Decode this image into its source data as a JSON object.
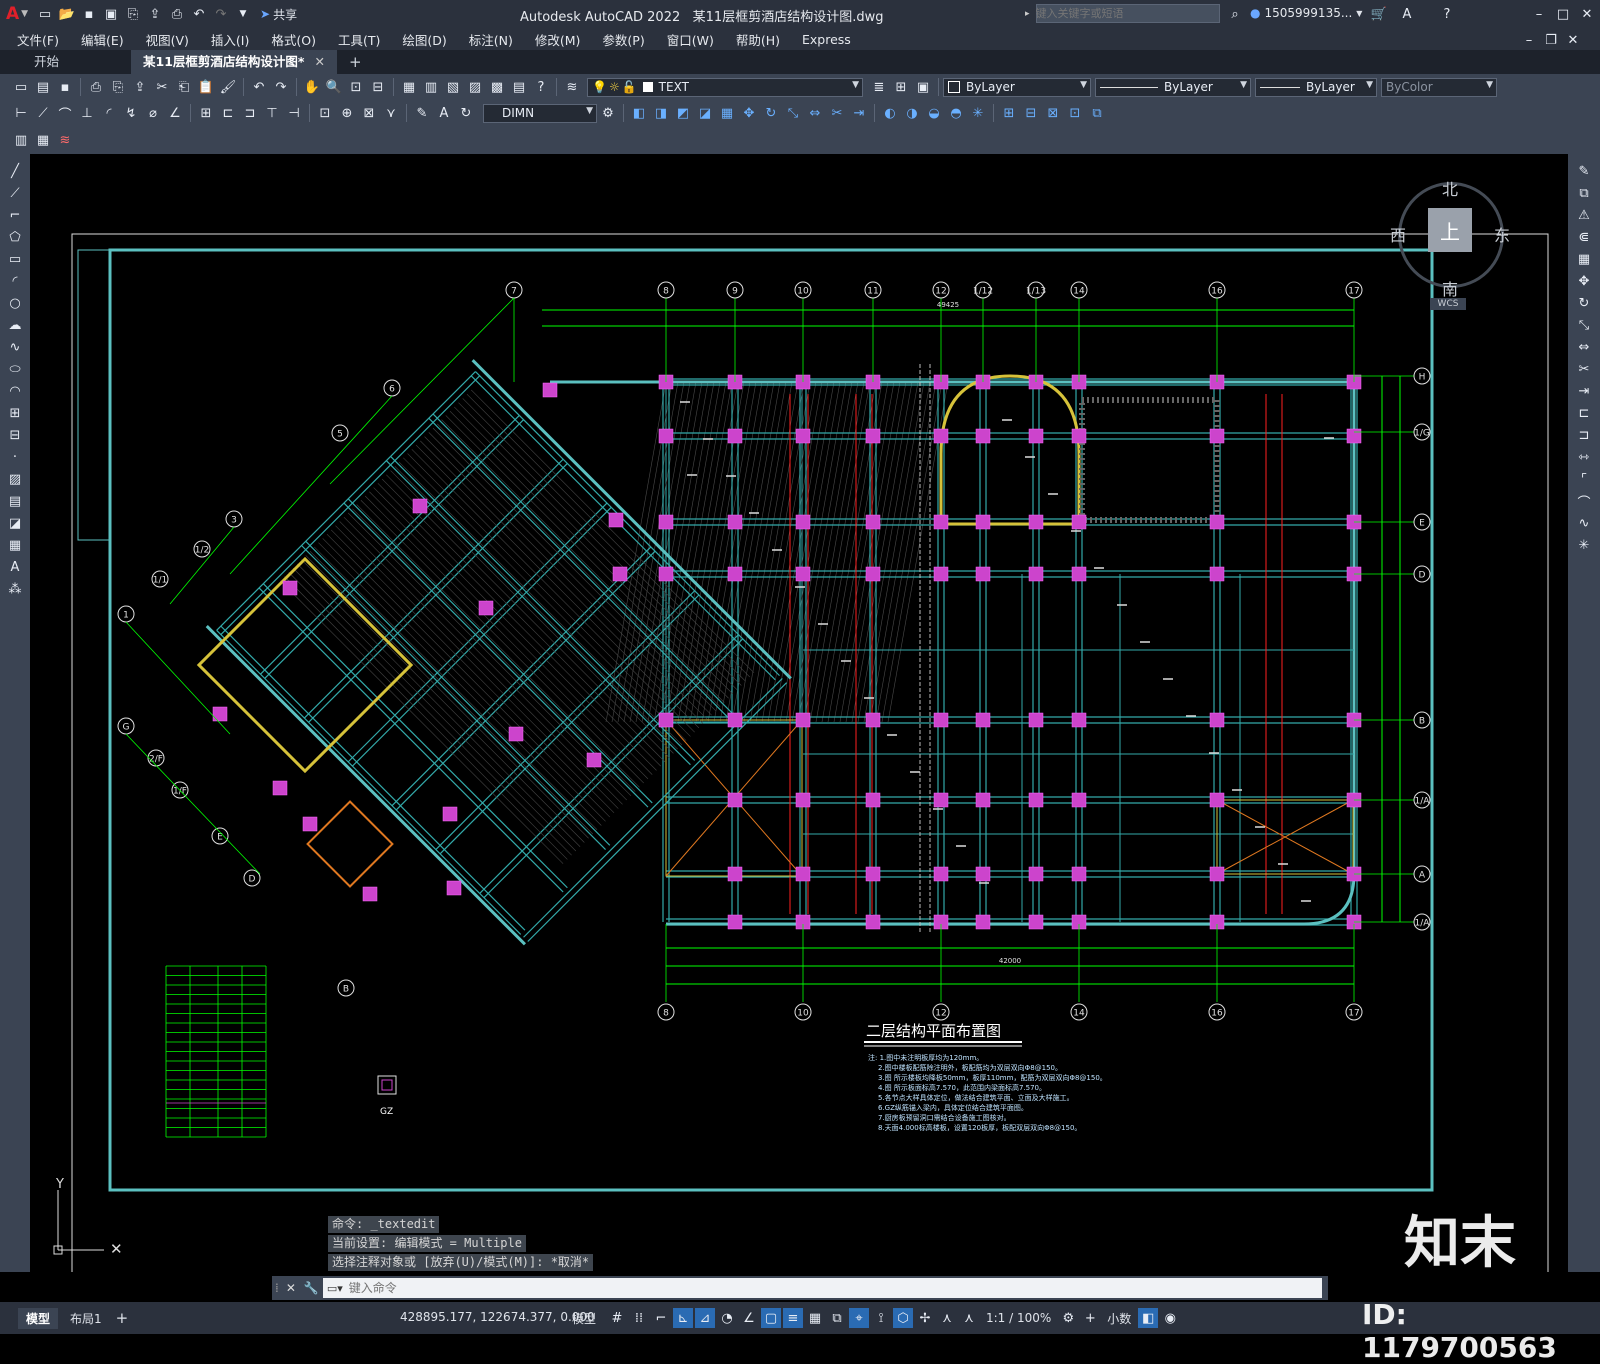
{
  "titlebar": {
    "app_title": "Autodesk AutoCAD 2022",
    "file_name": "某11层框剪酒店结构设计图.dwg",
    "share_label": "共享",
    "search_placeholder": "键入关键字或短语",
    "user": "1505999135...",
    "logo": "A"
  },
  "menu": [
    "文件(F)",
    "编辑(E)",
    "视图(V)",
    "插入(I)",
    "格式(O)",
    "工具(T)",
    "绘图(D)",
    "标注(N)",
    "修改(M)",
    "参数(P)",
    "窗口(W)",
    "帮助(H)",
    "Express"
  ],
  "tabs": {
    "start": "开始",
    "active": "某11层框剪酒店结构设计图*",
    "add": "+"
  },
  "toolbar": {
    "text_style": "TEXT",
    "dim_style": "DIMN",
    "layer": "ByLayer",
    "linetype": "ByLayer",
    "lineweight": "ByLayer",
    "color": "ByColor"
  },
  "viewcube": {
    "north": "北",
    "south": "南",
    "east": "东",
    "west": "西",
    "face": "上",
    "wcs": "WCS"
  },
  "drawing": {
    "title": "二层结构平面布置图",
    "col_section_label": "GZ",
    "grid_top": [
      "7",
      "8",
      "9",
      "10",
      "11",
      "12",
      "1/12",
      "1/13",
      "14",
      "16",
      "17"
    ],
    "grid_right": [
      "H",
      "1/G",
      "E",
      "D",
      "B",
      "1/A",
      "A",
      "1/A"
    ],
    "grid_bottom": [
      "8",
      "10",
      "12",
      "14",
      "16",
      "17"
    ],
    "grid_diag": [
      "6",
      "5",
      "3",
      "1/2",
      "1/1",
      "1",
      "G",
      "2/F",
      "1/F",
      "E",
      "D",
      "B"
    ],
    "total_dim_bottom": "42000",
    "total_dim_top": "49425",
    "notes": [
      "注: 1.图中未注明板厚均为120mm。",
      "2.图中楼板配筋除注明外，板配筋均为双层双向Φ8@150。",
      "3.图 所示楼板均降板50mm，板厚110mm，配筋为双层双向Φ8@150。",
      "4.图 所示板面标高7.570，此范围内梁面标高7.570。",
      "5.各节点大样具体定位，做法结合建筑平面、立面及大样施工。",
      "6.GZ纵筋锚入梁内，具体定位结合建筑平面图。",
      "7.厨房板预留洞口需结合设备施工图核对。",
      "8.天面4.000标高楼板，设置120板厚，板配双层双向Φ8@150。"
    ]
  },
  "command": {
    "history": [
      "命令: _textedit",
      "当前设置: 编辑模式 = Multiple",
      "选择注释对象或 [放弃(U)/模式(M)]: *取消*"
    ],
    "placeholder": "键入命令"
  },
  "status": {
    "model_tab": "模型",
    "layout_tab": "布局1",
    "coords": "428895.177, 122674.377, 0.000",
    "space": "模型",
    "scale": "1:1 / 100%",
    "units": "小数"
  },
  "watermark": {
    "brand": "知末",
    "id": "ID: 1179700563"
  },
  "colors": {
    "accent_green": "#00ff00",
    "beam_cyan": "#33aaaa",
    "column_magenta": "#cc44cc",
    "frame_cyan": "#5bc0c0",
    "yellow": "#d6c23a",
    "orange": "#e07820",
    "red": "#ff2020"
  }
}
